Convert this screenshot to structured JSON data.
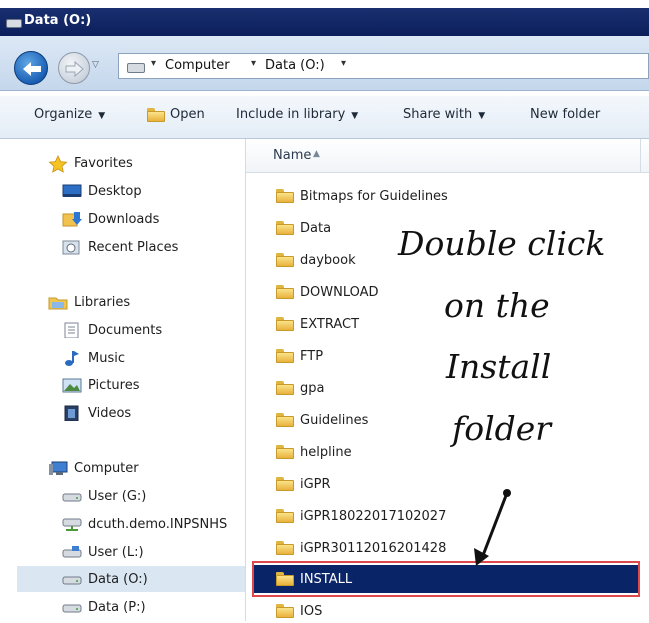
{
  "window": {
    "title": "Data (O:)"
  },
  "address": {
    "segments": [
      "Computer",
      "Data (O:)"
    ]
  },
  "toolbar": {
    "organize": "Organize",
    "open": "Open",
    "include": "Include in library",
    "share": "Share with",
    "new_folder": "New folder"
  },
  "nav": {
    "favorites": "Favorites",
    "desktop": "Desktop",
    "downloads": "Downloads",
    "recent": "Recent Places",
    "libraries": "Libraries",
    "documents": "Documents",
    "music": "Music",
    "pictures": "Pictures",
    "videos": "Videos",
    "computer": "Computer",
    "user_g": "User (G:)",
    "dcuth": "dcuth.demo.INPSNHS",
    "user_l": "User (L:)",
    "data_o": "Data (O:)",
    "data_p": "Data (P:)"
  },
  "column": {
    "name": "Name"
  },
  "files": [
    "Bitmaps for Guidelines",
    "Data",
    "daybook",
    "DOWNLOAD",
    "EXTRACT",
    "FTP",
    "gpa",
    "Guidelines",
    "helpline",
    "iGPR",
    "iGPR18022017102027",
    "iGPR30112016201428",
    "INSTALL",
    "IOS"
  ],
  "annotation": {
    "line1": "Double click",
    "line2": "on the",
    "line3": "Install",
    "line4": "folder"
  },
  "colors": {
    "selection": "#0a2468",
    "highlight_box": "#e0494b",
    "title_bar": "#0b1f5c"
  }
}
